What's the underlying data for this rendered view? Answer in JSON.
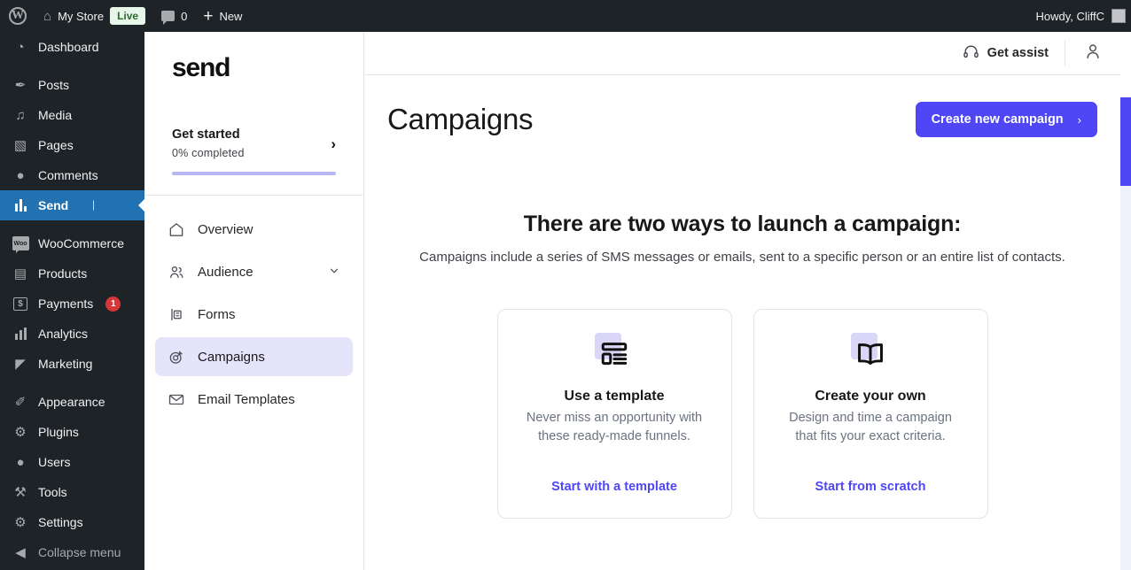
{
  "adminbar": {
    "logo_icon": "wordpress-logo-icon",
    "home_icon": "home-icon",
    "site_name": "My Store",
    "live_badge": "Live",
    "comments_icon": "comment-bubble-icon",
    "comments_count": "0",
    "new_icon": "plus-icon",
    "new_label": "New",
    "howdy": "Howdy, CliffC",
    "avatar": "avatar"
  },
  "wp_sidebar": {
    "items": [
      {
        "label": "Dashboard",
        "icon": "dashboard-icon",
        "glyph": "◔",
        "current": false,
        "badge": "",
        "gap_after": true
      },
      {
        "label": "Posts",
        "icon": "pin-icon",
        "glyph": "✒",
        "current": false,
        "badge": "",
        "gap_after": false
      },
      {
        "label": "Media",
        "icon": "media-icon",
        "glyph": "♫",
        "current": false,
        "badge": "",
        "gap_after": false
      },
      {
        "label": "Pages",
        "icon": "pages-icon",
        "glyph": "▧",
        "current": false,
        "badge": "",
        "gap_after": false
      },
      {
        "label": "Comments",
        "icon": "comments-icon",
        "glyph": "●",
        "current": false,
        "badge": "",
        "gap_after": false
      },
      {
        "label": "Send",
        "icon": "send-chart-icon",
        "glyph": "▐",
        "current": true,
        "badge": "",
        "gap_after": true
      },
      {
        "label": "WooCommerce",
        "icon": "woocommerce-icon",
        "glyph": "Woo",
        "current": false,
        "badge": "",
        "gap_after": false
      },
      {
        "label": "Products",
        "icon": "products-icon",
        "glyph": "▤",
        "current": false,
        "badge": "",
        "gap_after": false
      },
      {
        "label": "Payments",
        "icon": "payments-icon",
        "glyph": "$",
        "current": false,
        "badge": "1",
        "gap_after": false
      },
      {
        "label": "Analytics",
        "icon": "analytics-icon",
        "glyph": "█",
        "current": false,
        "badge": "",
        "gap_after": false
      },
      {
        "label": "Marketing",
        "icon": "megaphone-icon",
        "glyph": "◤",
        "current": false,
        "badge": "",
        "gap_after": true
      },
      {
        "label": "Appearance",
        "icon": "appearance-brush-icon",
        "glyph": "✐",
        "current": false,
        "badge": "",
        "gap_after": false
      },
      {
        "label": "Plugins",
        "icon": "plugins-icon",
        "glyph": "⚙",
        "current": false,
        "badge": "",
        "gap_after": false
      },
      {
        "label": "Users",
        "icon": "users-icon",
        "glyph": "●",
        "current": false,
        "badge": "",
        "gap_after": false
      },
      {
        "label": "Tools",
        "icon": "tools-wrench-icon",
        "glyph": "⚒",
        "current": false,
        "badge": "",
        "gap_after": false
      },
      {
        "label": "Settings",
        "icon": "settings-sliders-icon",
        "glyph": "⚙",
        "current": false,
        "badge": "",
        "gap_after": false
      },
      {
        "label": "Collapse menu",
        "icon": "collapse-icon",
        "glyph": "◀",
        "current": false,
        "badge": "",
        "gap_after": false
      }
    ]
  },
  "send_panel": {
    "logo_text": "send",
    "get_started": {
      "title": "Get started",
      "subtitle": "0% completed",
      "chevron_icon": "chevron-right-icon",
      "progress_percent": 0,
      "bar_color": "#b9b6f5"
    },
    "nav": [
      {
        "label": "Overview",
        "icon": "home-icon",
        "active": false,
        "chevron": ""
      },
      {
        "label": "Audience",
        "icon": "people-icon",
        "active": false,
        "chevron": "chevron-down-icon"
      },
      {
        "label": "Forms",
        "icon": "forms-icon",
        "active": false,
        "chevron": ""
      },
      {
        "label": "Campaigns",
        "icon": "target-campaign-icon",
        "active": true,
        "chevron": ""
      },
      {
        "label": "Email Templates",
        "icon": "envelope-icon",
        "active": false,
        "chevron": ""
      }
    ]
  },
  "main": {
    "topbar": {
      "assist_icon": "headphones-icon",
      "assist_label": "Get assist",
      "account_icon": "user-account-icon"
    },
    "page_title": "Campaigns",
    "create_button": {
      "label": "Create new campaign",
      "chevron_icon": "chevron-right-icon",
      "color": "#4f46f5"
    },
    "intro": {
      "heading": "There are two ways to launch a campaign:",
      "description": "Campaigns include a series of SMS messages or emails, sent to a specific person or an entire list of contacts."
    },
    "cards": [
      {
        "icon": "template-layout-icon",
        "title": "Use a template",
        "description": "Never miss an opportunity with these ready-made funnels.",
        "link_label": "Start with a template",
        "link_color": "#4f46f5"
      },
      {
        "icon": "open-book-icon",
        "title": "Create your own",
        "description": "Design and time a campaign that fits your exact criteria.",
        "link_label": "Start from scratch",
        "link_color": "#4f46f5"
      }
    ]
  }
}
